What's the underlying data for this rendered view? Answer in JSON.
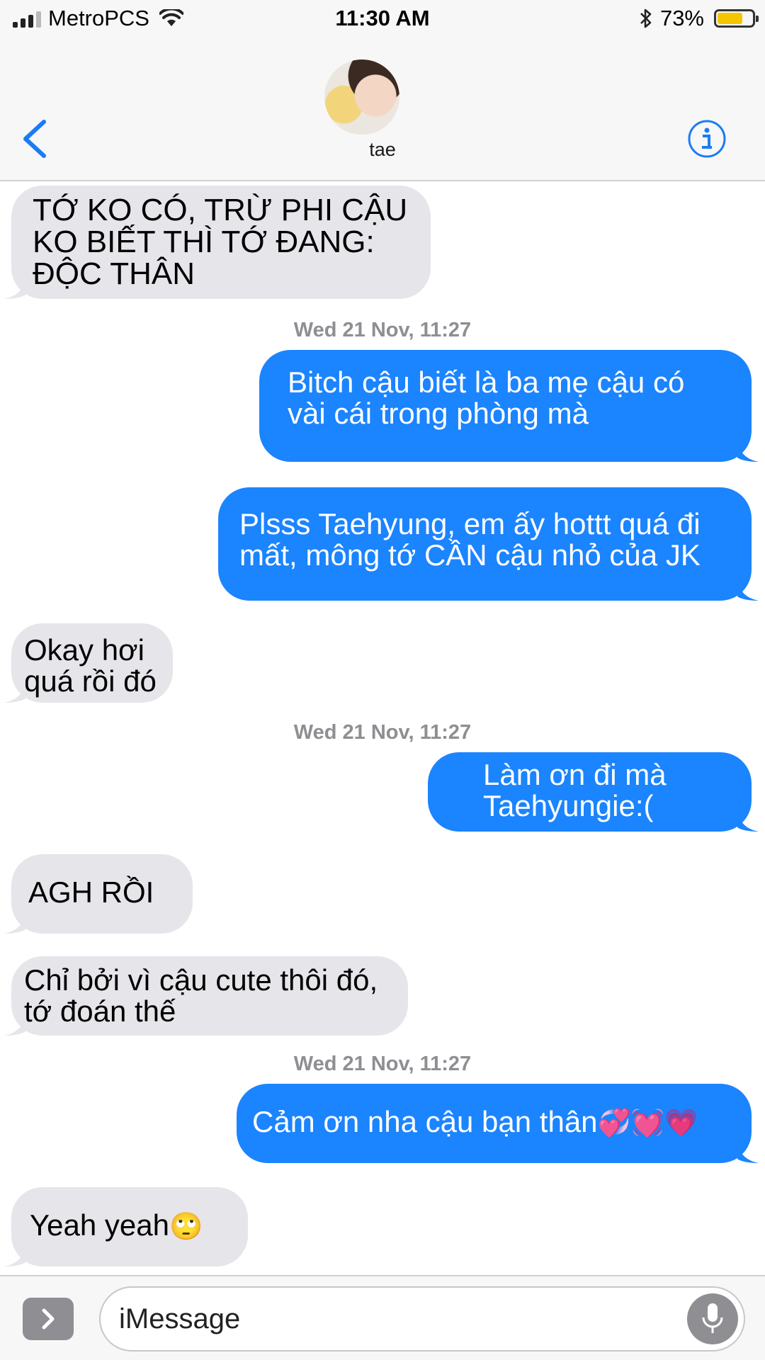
{
  "status_bar": {
    "carrier": "MetroPCS",
    "time": "11:30 AM",
    "battery_percent": "73%",
    "battery_level": 0.73,
    "icons": [
      "signal-bars-icon",
      "wifi-icon",
      "bluetooth-icon",
      "battery-icon"
    ]
  },
  "header": {
    "contact_name": "tae",
    "back_icon": "chevron-left-icon",
    "info_icon": "info-icon",
    "accent_color": "#1a7cf5"
  },
  "conversation": {
    "timestamps": [
      "Wed 21 Nov, 11:27",
      "Wed 21 Nov, 11:27",
      "Wed 21 Nov, 11:27"
    ],
    "messages": [
      {
        "direction": "received",
        "text": "TỚ KO CÓ, TRỪ PHI CẬU KO BIẾT THÌ TỚ ĐANG: ĐỘC THÂN"
      },
      {
        "direction": "sent",
        "text": "Bitch cậu biết là ba mẹ cậu có vài cái trong phòng mà"
      },
      {
        "direction": "sent",
        "text": "Plsss Taehyung, em ấy hottt quá đi mất, mông tớ CẦN cậu nhỏ của JK"
      },
      {
        "direction": "received",
        "text": "Okay hơi quá rồi đó"
      },
      {
        "direction": "sent",
        "text": "Làm ơn đi mà Taehyungie:("
      },
      {
        "direction": "received",
        "text": "AGH RỒI"
      },
      {
        "direction": "received",
        "text": "Chỉ bởi vì cậu cute thôi đó, tớ đoán thế"
      },
      {
        "direction": "sent",
        "text": "Cảm ơn nha cậu bạn thân",
        "emoji": "💞💓💗"
      },
      {
        "direction": "received",
        "text": "Yeah yeah",
        "emoji": "🙄"
      }
    ],
    "colors": {
      "sent_bubble": "#1b84ff",
      "received_bubble": "#e5e5ea",
      "timestamp": "#8e8e93"
    }
  },
  "input_bar": {
    "placeholder": "iMessage",
    "apps_icon": "chevron-right-icon",
    "mic_icon": "microphone-icon"
  }
}
